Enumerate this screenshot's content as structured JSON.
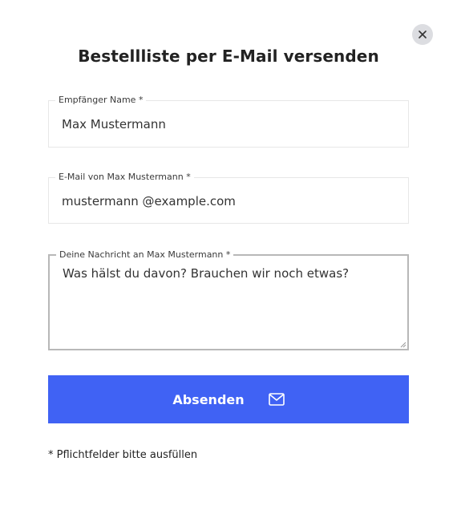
{
  "dialog": {
    "title": "Bestellliste per E-Mail versenden"
  },
  "form": {
    "recipient_name": {
      "label": "Empfänger Name *",
      "value": "Max Mustermann"
    },
    "email": {
      "label": "E-Mail von Max Mustermann *",
      "value": "mustermann @example.com"
    },
    "message": {
      "label": "Deine Nachricht an Max Mustermann *",
      "value": "Was hälst du davon? Brauchen wir noch etwas?"
    },
    "submit_label": "Absenden",
    "submit_icon": "envelope-icon",
    "required_note": "* Pflichtfelder bitte ausfüllen"
  },
  "colors": {
    "accent": "#4062f4",
    "close_bg": "#dcdde1"
  }
}
